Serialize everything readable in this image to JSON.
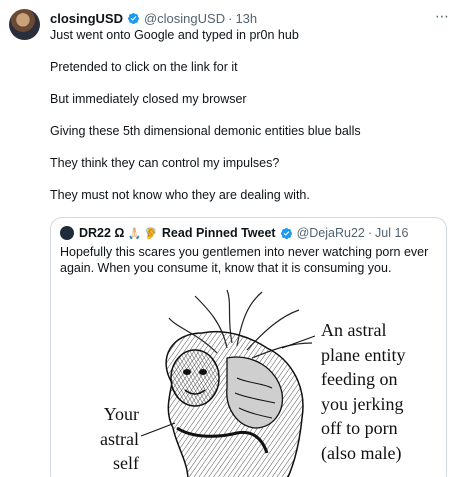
{
  "tweet": {
    "author_name": "closingUSD",
    "handle": "@closingUSD",
    "separator": "·",
    "time": "13h",
    "more_icon": "more-icon",
    "lines": [
      "Just went onto Google and typed in pr0n hub",
      "Pretended to click on the link for it",
      "But immediately closed my browser",
      "Giving these 5th dimensional demonic entities blue balls",
      "They think they can control my impulses?",
      "They must not know who they are dealing with."
    ]
  },
  "quote": {
    "author_name": "DR22 Ω",
    "emojis": "🙏🏻 🦻",
    "pinned": "Read Pinned Tweet",
    "handle": "@DejaRu22",
    "separator": "·",
    "date": "Jul 16",
    "text": "Hopefully this scares you gentlemen into never watching porn ever again. When you consume it, know that it is consuming you.",
    "image": {
      "caption_right": [
        "An astral",
        "plane entity",
        "feeding on",
        "you jerking",
        "off to porn",
        "(also male)"
      ],
      "caption_left": [
        "Your",
        "astral",
        "self"
      ]
    }
  },
  "colors": {
    "verified": "#1d9bf0",
    "secondary_text": "#536471",
    "border": "#cfd9de"
  }
}
